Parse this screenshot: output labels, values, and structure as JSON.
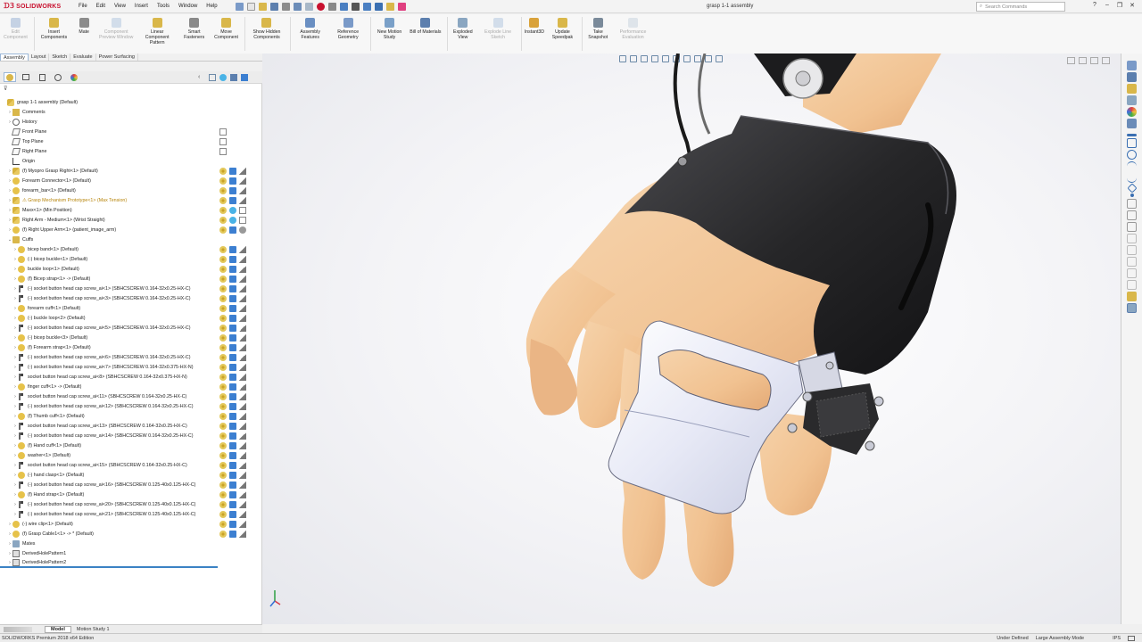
{
  "app": {
    "logo_text": "SOLIDWORKS",
    "document_title": "grasp 1-1 assembly"
  },
  "menu": [
    "File",
    "Edit",
    "View",
    "Insert",
    "Tools",
    "Window",
    "Help"
  ],
  "search": {
    "placeholder": "Search Commands"
  },
  "command_manager": [
    {
      "label": "Edit Component",
      "disabled": true,
      "icon": "edit-component-icon",
      "color": "#7a9ac8"
    },
    {
      "label": "Insert Components",
      "disabled": false,
      "icon": "insert-components-icon",
      "color": "#d9b74a"
    },
    {
      "label": "Mate",
      "disabled": false,
      "icon": "mate-icon",
      "color": "#8c8c8c"
    },
    {
      "label": "Component Preview Window",
      "disabled": true,
      "icon": "preview-window-icon",
      "color": "#9bb7d8"
    },
    {
      "label": "Linear Component Pattern",
      "disabled": false,
      "icon": "linear-pattern-icon",
      "color": "#d9b74a"
    },
    {
      "label": "Smart Fasteners",
      "disabled": false,
      "icon": "smart-fasteners-icon",
      "color": "#8a8a8a"
    },
    {
      "label": "Move Component",
      "disabled": false,
      "icon": "move-component-icon",
      "color": "#d9b74a"
    },
    {
      "label": "Show Hidden Components",
      "disabled": false,
      "icon": "show-hidden-icon",
      "color": "#d9b74a"
    },
    {
      "label": "Assembly Features",
      "disabled": false,
      "icon": "assembly-features-icon",
      "color": "#6a8fc2"
    },
    {
      "label": "Reference Geometry",
      "disabled": false,
      "icon": "reference-geometry-icon",
      "color": "#7a9ac8"
    },
    {
      "label": "New Motion Study",
      "disabled": false,
      "icon": "motion-study-icon",
      "color": "#7aa0c8"
    },
    {
      "label": "Bill of Materials",
      "disabled": false,
      "icon": "bom-icon",
      "color": "#5c7fae"
    },
    {
      "label": "Exploded View",
      "disabled": false,
      "icon": "exploded-view-icon",
      "color": "#8aa6c1"
    },
    {
      "label": "Explode Line Sketch",
      "disabled": true,
      "icon": "explode-line-icon",
      "color": "#9bb7d8"
    },
    {
      "label": "Instant3D",
      "disabled": false,
      "icon": "instant3d-icon",
      "color": "#d9a23a"
    },
    {
      "label": "Update Speedpak",
      "disabled": false,
      "icon": "speedpak-icon",
      "color": "#d9b74a"
    },
    {
      "label": "Take Snapshot",
      "disabled": false,
      "icon": "snapshot-icon",
      "color": "#7a8a9a"
    },
    {
      "label": "Performance Evaluation",
      "disabled": true,
      "icon": "performance-icon",
      "color": "#b9c7d6"
    }
  ],
  "tabs": [
    "Assembly",
    "Layout",
    "Sketch",
    "Evaluate",
    "Power Surfacing"
  ],
  "active_tab": "Assembly",
  "tree": [
    {
      "label": "grasp 1-1 assembly  (Default)",
      "icon": "asm",
      "indent": 0,
      "exp": ""
    },
    {
      "label": "Comments",
      "icon": "comments",
      "indent": 1,
      "exp": "›"
    },
    {
      "label": "History",
      "icon": "history",
      "indent": 1,
      "exp": "›"
    },
    {
      "label": "Front Plane",
      "icon": "plane",
      "indent": 1,
      "exp": ""
    },
    {
      "label": "Top Plane",
      "icon": "plane",
      "indent": 1,
      "exp": ""
    },
    {
      "label": "Right Plane",
      "icon": "plane",
      "indent": 1,
      "exp": ""
    },
    {
      "label": "Origin",
      "icon": "origin",
      "indent": 1,
      "exp": ""
    },
    {
      "label": "(f) Myopro Grasp Right<1> (Default)",
      "icon": "asm",
      "indent": 1,
      "exp": "›"
    },
    {
      "label": "Forearm Connector<1> (Default)",
      "icon": "part",
      "indent": 1,
      "exp": "›"
    },
    {
      "label": "forearm_bar<1> (Default)",
      "icon": "part",
      "indent": 1,
      "exp": "›"
    },
    {
      "label": "⚠ Grasp Mechanism Prototype<1> (Max Tension)",
      "icon": "asm",
      "indent": 1,
      "exp": "›",
      "warn": true
    },
    {
      "label": "Maxx<1> (Min Position)",
      "icon": "asm",
      "indent": 1,
      "exp": "›"
    },
    {
      "label": "Right Arm - Medium<1> (Wrist Straight)",
      "icon": "asm",
      "indent": 1,
      "exp": "›"
    },
    {
      "label": "(f) Right Upper Arm<1> (patient_image_arm)",
      "icon": "part",
      "indent": 1,
      "exp": "›"
    },
    {
      "label": "Cuffs",
      "icon": "folder",
      "indent": 1,
      "exp": "⌄"
    },
    {
      "label": "bicep band<1> (Default)",
      "icon": "part",
      "indent": 2,
      "exp": "›"
    },
    {
      "label": "(-) bicep buckle<1> (Default)",
      "icon": "part",
      "indent": 2,
      "exp": "›"
    },
    {
      "label": "buckle loop<1> (Default)",
      "icon": "part",
      "indent": 2,
      "exp": "›"
    },
    {
      "label": "(f) Bicep strap<1> -> (Default)",
      "icon": "part",
      "indent": 2,
      "exp": "›"
    },
    {
      "label": "(-) socket button head cap screw_ai<1> (SBHCSCREW 0.164-32x0.25-HX-C)",
      "icon": "screw",
      "indent": 2,
      "exp": "›"
    },
    {
      "label": "(-) socket button head cap screw_ai<3> (SBHCSCREW 0.164-32x0.25-HX-C)",
      "icon": "screw",
      "indent": 2,
      "exp": "›"
    },
    {
      "label": "forearm cuff<1> (Default)",
      "icon": "part",
      "indent": 2,
      "exp": "›"
    },
    {
      "label": "(-) buckle loop<2> (Default)",
      "icon": "part",
      "indent": 2,
      "exp": "›"
    },
    {
      "label": "(-) socket button head cap screw_ai<5> (SBHCSCREW 0.164-32x0.25-HX-C)",
      "icon": "screw",
      "indent": 2,
      "exp": "›"
    },
    {
      "label": "(-) bicep buckle<3> (Default)",
      "icon": "part",
      "indent": 2,
      "exp": "›"
    },
    {
      "label": "(f) Forearm strap<1> (Default)",
      "icon": "part",
      "indent": 2,
      "exp": "›"
    },
    {
      "label": "(-) socket button head cap screw_ai<6> (SBHCSCREW 0.164-32x0.25-HX-C)",
      "icon": "screw",
      "indent": 2,
      "exp": "›"
    },
    {
      "label": "(-) socket button head cap screw_ai<7> (SBHCSCREW 0.164-32x0.375-HX-N)",
      "icon": "screw",
      "indent": 2,
      "exp": "›"
    },
    {
      "label": "socket button head cap screw_ai<8> (SBHCSCREW 0.164-32x0.375-HX-N)",
      "icon": "screw",
      "indent": 2,
      "exp": "›"
    },
    {
      "label": "finger cuff<1> -> (Default)",
      "icon": "part",
      "indent": 2,
      "exp": "›"
    },
    {
      "label": "socket button head cap screw_ai<11> (SBHCSCREW 0.164-32x0.25-HX-C)",
      "icon": "screw",
      "indent": 2,
      "exp": "›"
    },
    {
      "label": "(-) socket button head cap screw_ai<12> (SBHCSCREW 0.164-32x0.25-HX-C)",
      "icon": "screw",
      "indent": 2,
      "exp": "›"
    },
    {
      "label": "(f) Thumb cuff<1> (Default)",
      "icon": "part",
      "indent": 2,
      "exp": "›"
    },
    {
      "label": "socket button head cap screw_ai<13> (SBHCSCREW 0.164-32x0.25-HX-C)",
      "icon": "screw",
      "indent": 2,
      "exp": "›"
    },
    {
      "label": "(-) socket button head cap screw_ai<14> (SBHCSCREW 0.164-32x0.25-HX-C)",
      "icon": "screw",
      "indent": 2,
      "exp": "›"
    },
    {
      "label": "(f) Hand cuff<1> (Default)",
      "icon": "part",
      "indent": 2,
      "exp": "›"
    },
    {
      "label": "washer<1> (Default)",
      "icon": "part",
      "indent": 2,
      "exp": "›"
    },
    {
      "label": "socket button head cap screw_ai<15> (SBHCSCREW 0.164-32x0.25-HX-C)",
      "icon": "screw",
      "indent": 2,
      "exp": "›"
    },
    {
      "label": "(-) hand clasp<1> (Default)",
      "icon": "part",
      "indent": 2,
      "exp": "›"
    },
    {
      "label": "(-) socket button head cap screw_ai<16> (SBHCSCREW 0.125-40x0.125-HX-C)",
      "icon": "screw",
      "indent": 2,
      "exp": "›"
    },
    {
      "label": "(f) Hand strap<1> (Default)",
      "icon": "part",
      "indent": 2,
      "exp": "›"
    },
    {
      "label": "(-) socket button head cap screw_ai<20> (SBHCSCREW 0.125-40x0.125-HX-C)",
      "icon": "screw",
      "indent": 2,
      "exp": "›"
    },
    {
      "label": "(-) socket button head cap screw_ai<21> (SBHCSCREW 0.125-40x0.125-HX-C)",
      "icon": "screw",
      "indent": 2,
      "exp": "›"
    },
    {
      "label": "(-) wire clip<1> (Default)",
      "icon": "part",
      "indent": 1,
      "exp": "›"
    },
    {
      "label": "(f) Grasp Cable1<1> -> * (Default)",
      "icon": "part",
      "indent": 1,
      "exp": "›"
    },
    {
      "label": "Mates",
      "icon": "mates",
      "indent": 1,
      "exp": "›"
    },
    {
      "label": "DerivedHolePattern1",
      "icon": "pattern",
      "indent": 1,
      "exp": "›"
    },
    {
      "label": "DerivedHolePattern2",
      "icon": "pattern",
      "indent": 1,
      "exp": "›"
    }
  ],
  "bottom_tabs": {
    "model": "Model",
    "motion": "Motion Study 1"
  },
  "status": {
    "edition": "SOLIDWORKS Premium 2018 x64 Edition",
    "under_defined": "Under Defined",
    "mode": "Large Assembly Mode",
    "units": "IPS"
  },
  "colors": {
    "accent": "#3b82c4",
    "brand": "#c8102e",
    "skin": "#f2c89a",
    "brace_dark": "#2a2a2c",
    "cuff": "#eef0f8"
  }
}
